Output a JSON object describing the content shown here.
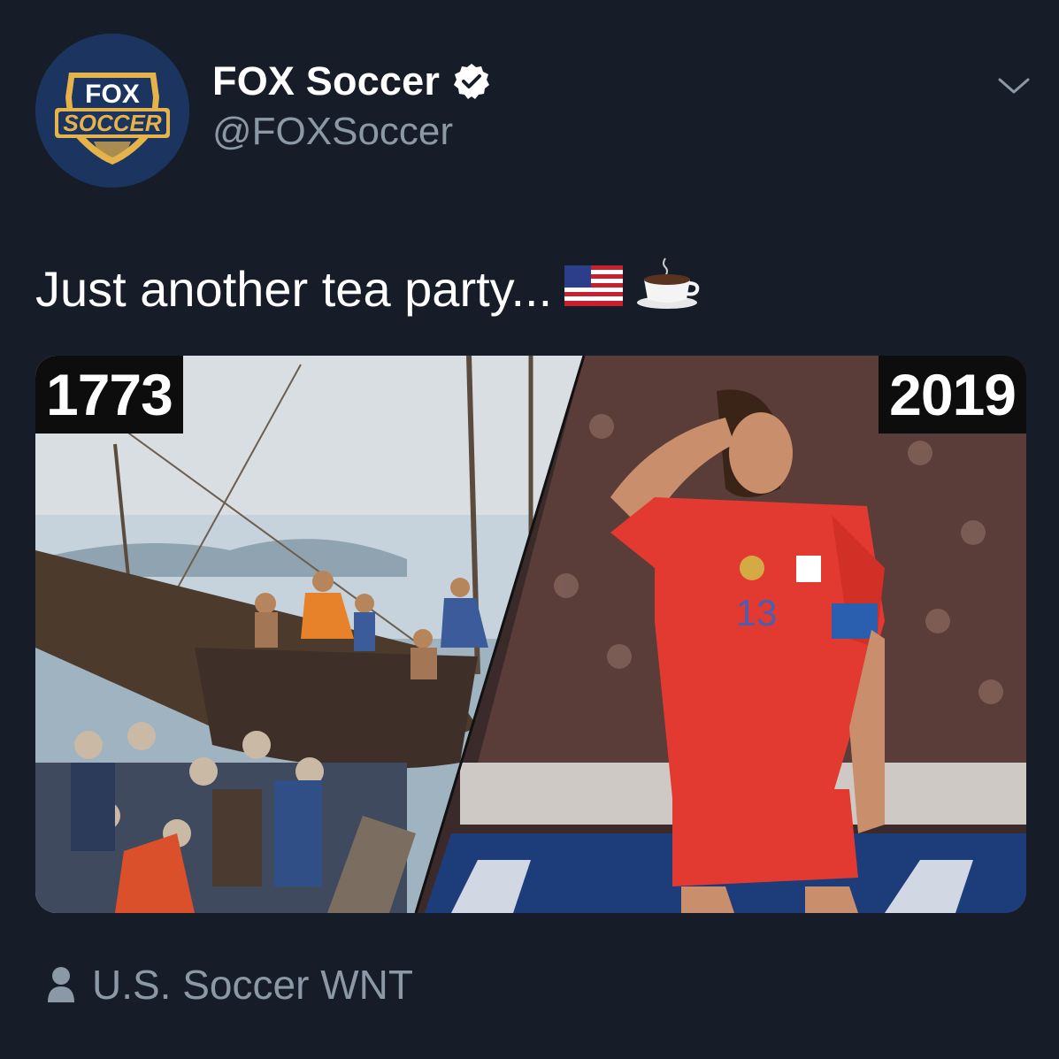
{
  "account": {
    "logo_lines": [
      "FOX",
      "SOCCER"
    ],
    "display_name": "FOX Soccer",
    "handle": "@FOXSoccer",
    "verified": true
  },
  "tweet": {
    "text": "Just another tea party...",
    "emojis": [
      "us-flag-emoji",
      "coffee-cup-emoji"
    ]
  },
  "media": {
    "left_year": "1773",
    "right_year": "2019",
    "jersey_number": "13"
  },
  "tagged": {
    "icon": "person-icon",
    "label": "U.S. Soccer WNT"
  },
  "colors": {
    "background": "#161c28",
    "secondary_text": "#8b98a5",
    "logo_blue": "#1b3560",
    "logo_gold": "#e5b34a",
    "jersey_red": "#e23a30"
  }
}
